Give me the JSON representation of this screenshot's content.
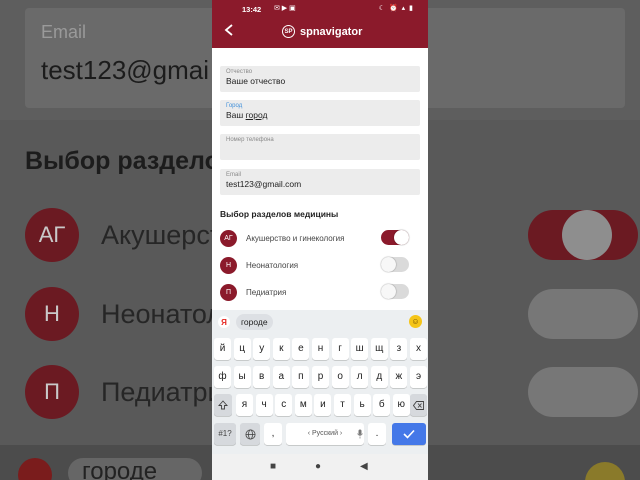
{
  "status_bar": {
    "time": "13:42",
    "left_icons": "✉ ▶ ▣",
    "right_icons": "☾ ⏰ ▴ ▮"
  },
  "app_bar": {
    "back_icon": "arrow-left-icon",
    "logo_text": "SP",
    "brand": "spnavigator"
  },
  "fields": [
    {
      "label": "Отчество",
      "value": "Ваше отчество",
      "active": false
    },
    {
      "label": "Город",
      "value_prefix": "Ваш ",
      "value_underlined": "город",
      "active": true
    },
    {
      "label": "Номер телефона",
      "value": "",
      "active": false
    },
    {
      "label": "Email",
      "value": "test123@gmail.com",
      "active": false
    }
  ],
  "section_title": "Выбор разделов медицины",
  "specialties": [
    {
      "badge": "АГ",
      "name": "Акушерство и гинекология",
      "enabled": true
    },
    {
      "badge": "Н",
      "name": "Неонатология",
      "enabled": false
    },
    {
      "badge": "П",
      "name": "Педиатрия",
      "enabled": false
    }
  ],
  "keyboard": {
    "logo": "Я",
    "suggestion": "городе",
    "emoji_icon": "smiley-icon",
    "row1": [
      "й",
      "ц",
      "у",
      "к",
      "е",
      "н",
      "г",
      "ш",
      "щ",
      "з",
      "х"
    ],
    "row2": [
      "ф",
      "ы",
      "в",
      "а",
      "п",
      "р",
      "о",
      "л",
      "д",
      "ж",
      "э"
    ],
    "row3": [
      "я",
      "ч",
      "с",
      "м",
      "и",
      "т",
      "ь",
      "б",
      "ю"
    ],
    "shift_icon": "shift-icon",
    "backspace_icon": "backspace-icon",
    "sym_label": "#1?",
    "globe_icon": "globe-icon",
    "comma": ",",
    "space_label": "‹ Русский ›",
    "period": ".",
    "enter_icon": "checkmark-icon"
  },
  "background": {
    "email_label": "Email",
    "email_value": "test123@gmai",
    "section_fragment": "Выбор разделов",
    "rows": [
      {
        "badge": "АГ",
        "text": "Акушерств"
      },
      {
        "badge": "Н",
        "text": "Неонатол"
      },
      {
        "badge": "П",
        "text": "Педиатри"
      }
    ],
    "suggestion_fragment": "городе"
  },
  "navbar": {
    "recents": "■",
    "home": "●",
    "back": "◀"
  },
  "colors": {
    "brand": "#8b1a2b",
    "active_label": "#3f8fd9",
    "enter_key": "#4478e8"
  }
}
